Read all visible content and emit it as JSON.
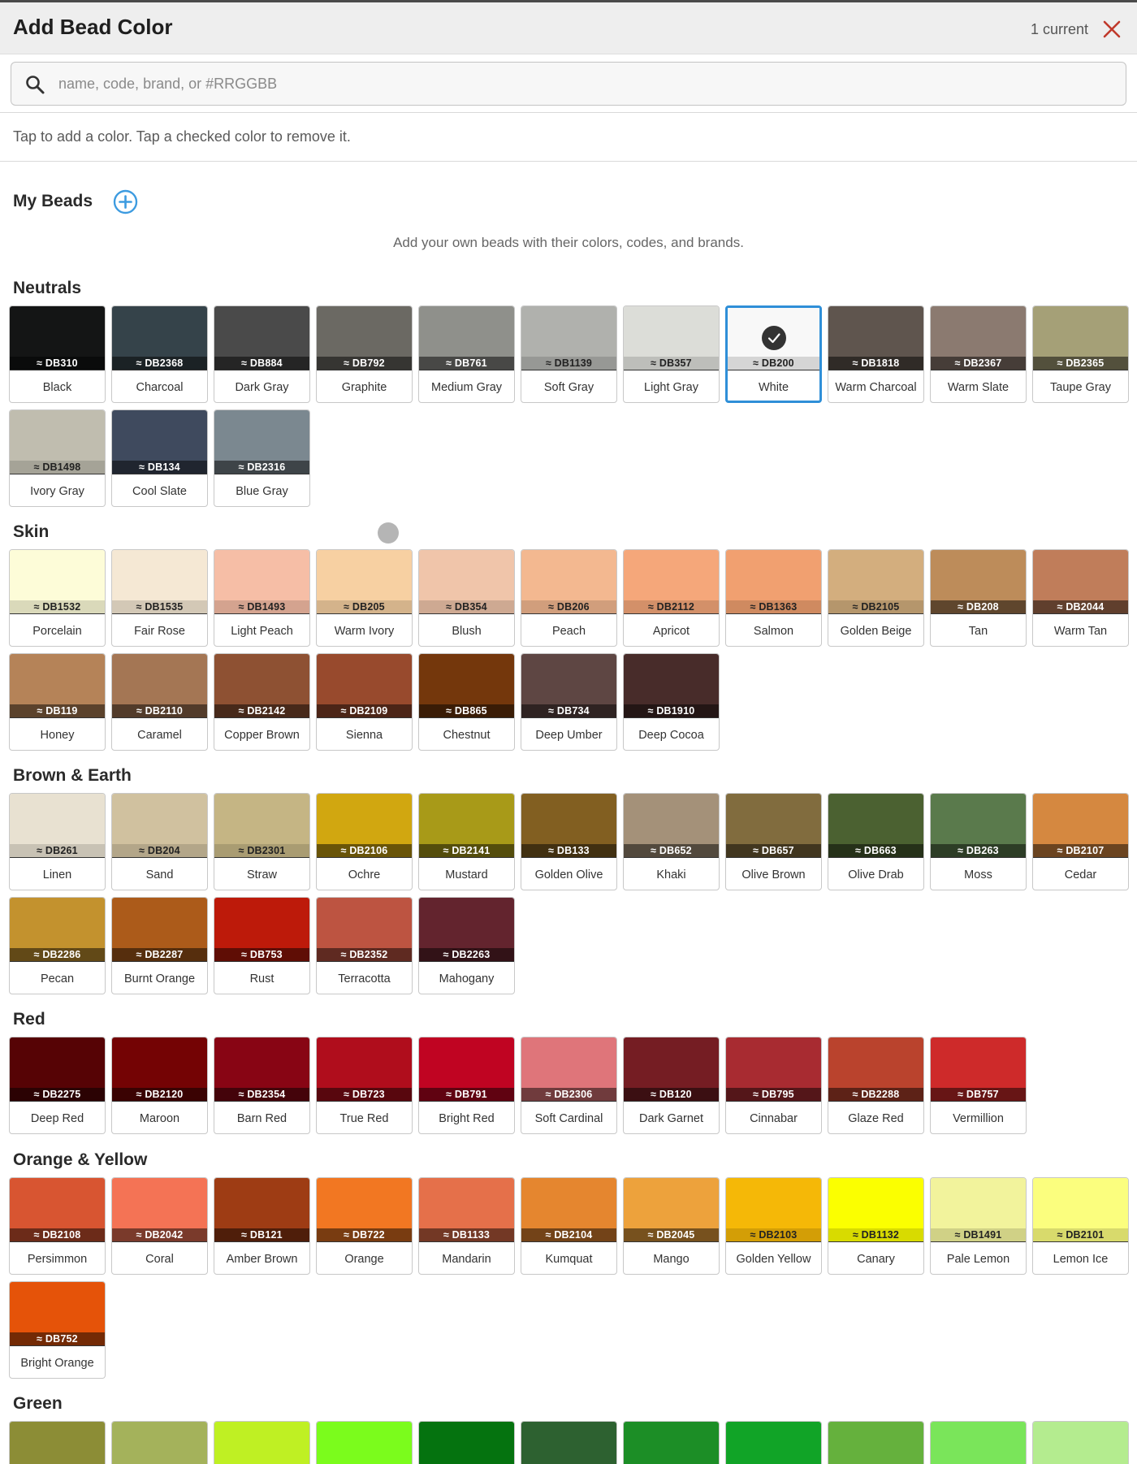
{
  "header": {
    "title": "Add Bead Color",
    "current_count": "1 current",
    "close_icon": "close-icon",
    "accent": "#c0392b"
  },
  "search": {
    "placeholder": "name, code, brand, or #RRGGBB",
    "value": "",
    "icon": "search-icon"
  },
  "instruction": "Tap to add a color. Tap a checked color to remove it.",
  "my_beads": {
    "title": "My Beads",
    "add_icon": "add-circle-icon",
    "hint": "Add your own beads with their colors, codes, and brands."
  },
  "selection_color": "#2f8fd8",
  "sections": [
    {
      "title": "Neutrals",
      "colors": [
        {
          "name": "Black",
          "code": "≈ DB310",
          "hex": "#141515"
        },
        {
          "name": "Charcoal",
          "code": "≈ DB2368",
          "hex": "#35434a"
        },
        {
          "name": "Dark Gray",
          "code": "≈ DB884",
          "hex": "#4a4a4a"
        },
        {
          "name": "Graphite",
          "code": "≈ DB792",
          "hex": "#6b6963"
        },
        {
          "name": "Medium Gray",
          "code": "≈ DB761",
          "hex": "#8f908b"
        },
        {
          "name": "Soft Gray",
          "code": "≈ DB1139",
          "hex": "#b0b1ad"
        },
        {
          "name": "Light Gray",
          "code": "≈ DB357",
          "hex": "#dcddd8"
        },
        {
          "name": "White",
          "code": "≈ DB200",
          "hex": "#f8f8f8",
          "selected": true
        },
        {
          "name": "Warm Charcoal",
          "code": "≈ DB1818",
          "hex": "#5f554e"
        },
        {
          "name": "Warm Slate",
          "code": "≈ DB2367",
          "hex": "#8b7a70"
        },
        {
          "name": "Taupe Gray",
          "code": "≈ DB2365",
          "hex": "#a5a077"
        },
        {
          "name": "Ivory Gray",
          "code": "≈ DB1498",
          "hex": "#c0bdaf"
        },
        {
          "name": "Cool Slate",
          "code": "≈ DB134",
          "hex": "#3f4a5e"
        },
        {
          "name": "Blue Gray",
          "code": "≈ DB2316",
          "hex": "#7b8890"
        }
      ]
    },
    {
      "title": "Skin",
      "colors": [
        {
          "name": "Porcelain",
          "code": "≈ DB1532",
          "hex": "#fdfcd8"
        },
        {
          "name": "Fair Rose",
          "code": "≈ DB1535",
          "hex": "#f5e8d4"
        },
        {
          "name": "Light Peach",
          "code": "≈ DB1493",
          "hex": "#f6bea6"
        },
        {
          "name": "Warm Ivory",
          "code": "≈ DB205",
          "hex": "#f7d0a2"
        },
        {
          "name": "Blush",
          "code": "≈ DB354",
          "hex": "#f0c5aa"
        },
        {
          "name": "Peach",
          "code": "≈ DB206",
          "hex": "#f3b890"
        },
        {
          "name": "Apricot",
          "code": "≈ DB2112",
          "hex": "#f5a77a"
        },
        {
          "name": "Salmon",
          "code": "≈ DB1363",
          "hex": "#f1a070"
        },
        {
          "name": "Golden Beige",
          "code": "≈ DB2105",
          "hex": "#d3ae7e"
        },
        {
          "name": "Tan",
          "code": "≈ DB208",
          "hex": "#bd8c5a"
        },
        {
          "name": "Warm Tan",
          "code": "≈ DB2044",
          "hex": "#c07d5a"
        },
        {
          "name": "Honey",
          "code": "≈ DB119",
          "hex": "#b58358"
        },
        {
          "name": "Caramel",
          "code": "≈ DB2110",
          "hex": "#a47654"
        },
        {
          "name": "Copper Brown",
          "code": "≈ DB2142",
          "hex": "#8e5133"
        },
        {
          "name": "Sienna",
          "code": "≈ DB2109",
          "hex": "#984a2d"
        },
        {
          "name": "Chestnut",
          "code": "≈ DB865",
          "hex": "#74370c"
        },
        {
          "name": "Deep Umber",
          "code": "≈ DB734",
          "hex": "#5e4643"
        },
        {
          "name": "Deep Cocoa",
          "code": "≈ DB1910",
          "hex": "#482c2a"
        }
      ]
    },
    {
      "title": "Brown & Earth",
      "colors": [
        {
          "name": "Linen",
          "code": "≈ DB261",
          "hex": "#e8e1d1"
        },
        {
          "name": "Sand",
          "code": "≈ DB204",
          "hex": "#d0c19f"
        },
        {
          "name": "Straw",
          "code": "≈ DB2301",
          "hex": "#c5b584"
        },
        {
          "name": "Ochre",
          "code": "≈ DB2106",
          "hex": "#d1a710"
        },
        {
          "name": "Mustard",
          "code": "≈ DB2141",
          "hex": "#a89a18"
        },
        {
          "name": "Golden Olive",
          "code": "≈ DB133",
          "hex": "#825f21"
        },
        {
          "name": "Khaki",
          "code": "≈ DB652",
          "hex": "#a49179"
        },
        {
          "name": "Olive Brown",
          "code": "≈ DB657",
          "hex": "#816c3e"
        },
        {
          "name": "Olive Drab",
          "code": "≈ DB663",
          "hex": "#4b6131"
        },
        {
          "name": "Moss",
          "code": "≈ DB263",
          "hex": "#5a7a4c"
        },
        {
          "name": "Cedar",
          "code": "≈ DB2107",
          "hex": "#d58840"
        },
        {
          "name": "Pecan",
          "code": "≈ DB2286",
          "hex": "#c3922e"
        },
        {
          "name": "Burnt Orange",
          "code": "≈ DB2287",
          "hex": "#ac5b1a"
        },
        {
          "name": "Rust",
          "code": "≈ DB753",
          "hex": "#bd1a0a"
        },
        {
          "name": "Terracotta",
          "code": "≈ DB2352",
          "hex": "#bd5441"
        },
        {
          "name": "Mahogany",
          "code": "≈ DB2263",
          "hex": "#63242e"
        }
      ]
    },
    {
      "title": "Red",
      "colors": [
        {
          "name": "Deep Red",
          "code": "≈ DB2275",
          "hex": "#560305"
        },
        {
          "name": "Maroon",
          "code": "≈ DB2120",
          "hex": "#740304"
        },
        {
          "name": "Barn Red",
          "code": "≈ DB2354",
          "hex": "#880514"
        },
        {
          "name": "True Red",
          "code": "≈ DB723",
          "hex": "#b00d1c"
        },
        {
          "name": "Bright Red",
          "code": "≈ DB791",
          "hex": "#c00422"
        },
        {
          "name": "Soft Cardinal",
          "code": "≈ DB2306",
          "hex": "#df757a"
        },
        {
          "name": "Dark Garnet",
          "code": "≈ DB120",
          "hex": "#751d23"
        },
        {
          "name": "Cinnabar",
          "code": "≈ DB795",
          "hex": "#a82b31"
        },
        {
          "name": "Glaze Red",
          "code": "≈ DB2288",
          "hex": "#ba432d"
        },
        {
          "name": "Vermillion",
          "code": "≈ DB757",
          "hex": "#ce2a2a"
        }
      ]
    },
    {
      "title": "Orange & Yellow",
      "colors": [
        {
          "name": "Persimmon",
          "code": "≈ DB2108",
          "hex": "#d85531"
        },
        {
          "name": "Coral",
          "code": "≈ DB2042",
          "hex": "#f47355"
        },
        {
          "name": "Amber Brown",
          "code": "≈ DB121",
          "hex": "#9e3c14"
        },
        {
          "name": "Orange",
          "code": "≈ DB722",
          "hex": "#f27722"
        },
        {
          "name": "Mandarin",
          "code": "≈ DB1133",
          "hex": "#e5704a"
        },
        {
          "name": "Kumquat",
          "code": "≈ DB2104",
          "hex": "#e5862f"
        },
        {
          "name": "Mango",
          "code": "≈ DB2045",
          "hex": "#eda23c"
        },
        {
          "name": "Golden Yellow",
          "code": "≈ DB2103",
          "hex": "#f5b807"
        },
        {
          "name": "Canary",
          "code": "≈ DB1132",
          "hex": "#fbff00"
        },
        {
          "name": "Pale Lemon",
          "code": "≈ DB1491",
          "hex": "#f2f39c"
        },
        {
          "name": "Lemon Ice",
          "code": "≈ DB2101",
          "hex": "#fbfe7e"
        },
        {
          "name": "Bright Orange",
          "code": "≈ DB752",
          "hex": "#e55309"
        }
      ]
    },
    {
      "title": "Green",
      "colors": [
        {
          "name": "",
          "code": "",
          "hex": "#8c8d36"
        },
        {
          "name": "",
          "code": "",
          "hex": "#a4b25b"
        },
        {
          "name": "",
          "code": "",
          "hex": "#bff023"
        },
        {
          "name": "",
          "code": "",
          "hex": "#7bfc1c"
        },
        {
          "name": "",
          "code": "",
          "hex": "#05730f"
        },
        {
          "name": "",
          "code": "",
          "hex": "#2d6130"
        },
        {
          "name": "",
          "code": "",
          "hex": "#1c8e26"
        },
        {
          "name": "",
          "code": "",
          "hex": "#11a427"
        },
        {
          "name": "",
          "code": "",
          "hex": "#65b13d"
        },
        {
          "name": "",
          "code": "",
          "hex": "#7ae55a"
        },
        {
          "name": "",
          "code": "",
          "hex": "#b4ec8f"
        }
      ]
    }
  ]
}
